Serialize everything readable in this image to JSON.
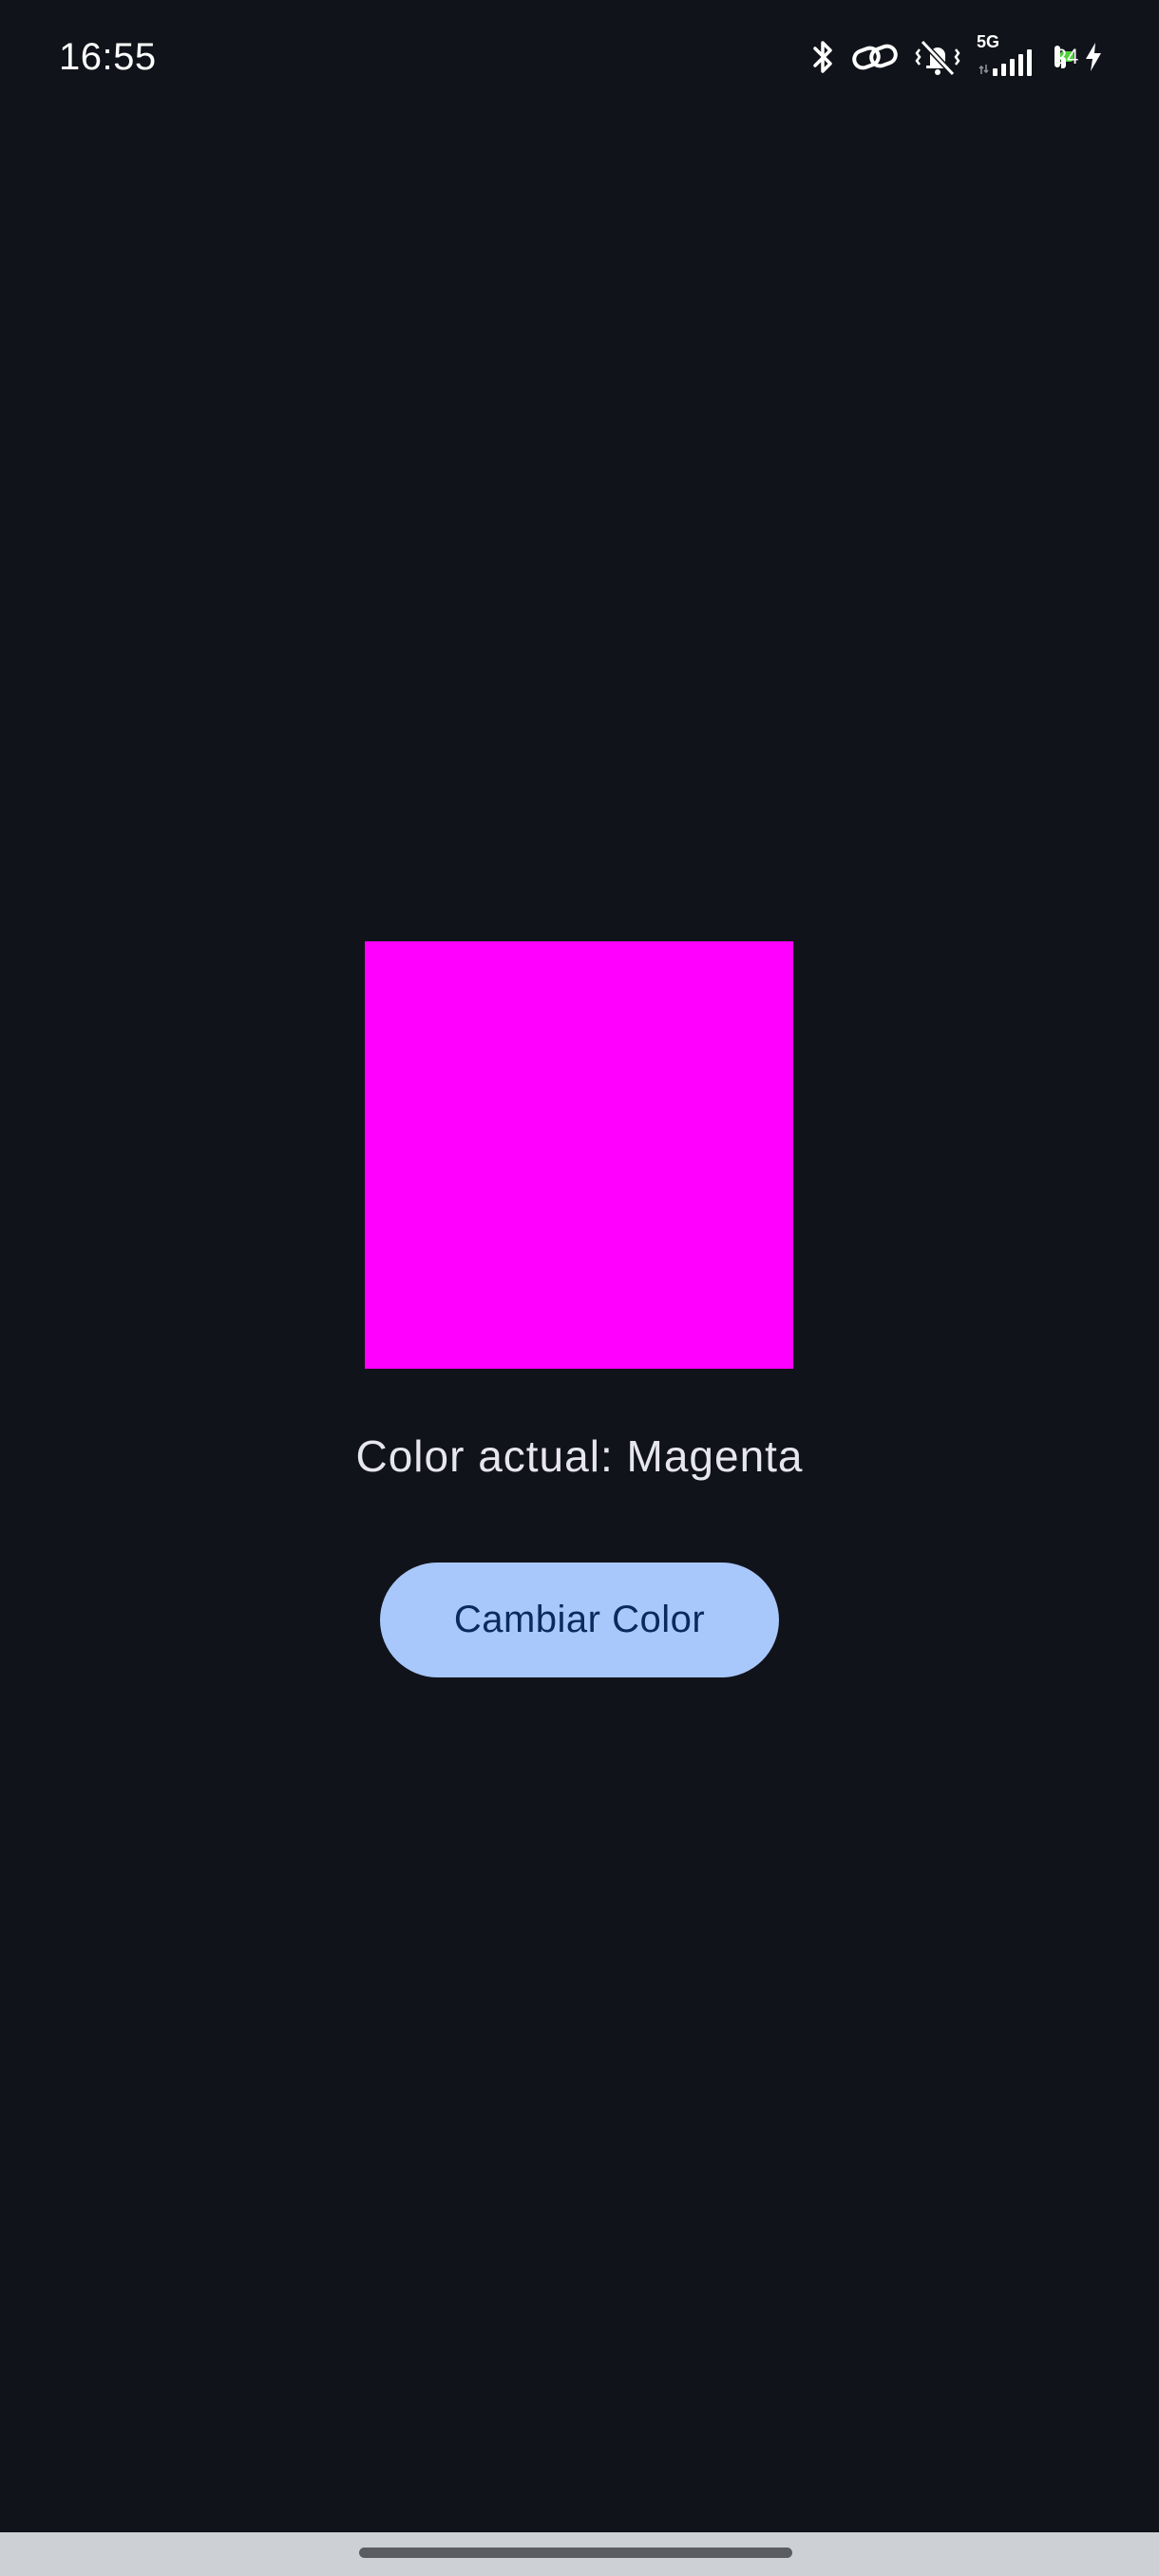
{
  "status_bar": {
    "time": "16:55",
    "network_label": "5G",
    "battery_level": "24",
    "battery_fraction": 0.24,
    "icons": [
      "bluetooth-icon",
      "link-icon",
      "vibrate-mute-icon",
      "signal-5g-icon",
      "battery-icon",
      "charging-bolt-icon"
    ]
  },
  "main": {
    "current_color_hex": "#ff00ff",
    "color_label": "Color actual: Magenta",
    "button_label": "Cambiar Color"
  },
  "colors": {
    "background": "#11131a",
    "button_background": "#a8c7fa",
    "button_text": "#0b2a5c",
    "battery_fill": "#4cd137",
    "nav_bar": "#cdd0d4"
  }
}
